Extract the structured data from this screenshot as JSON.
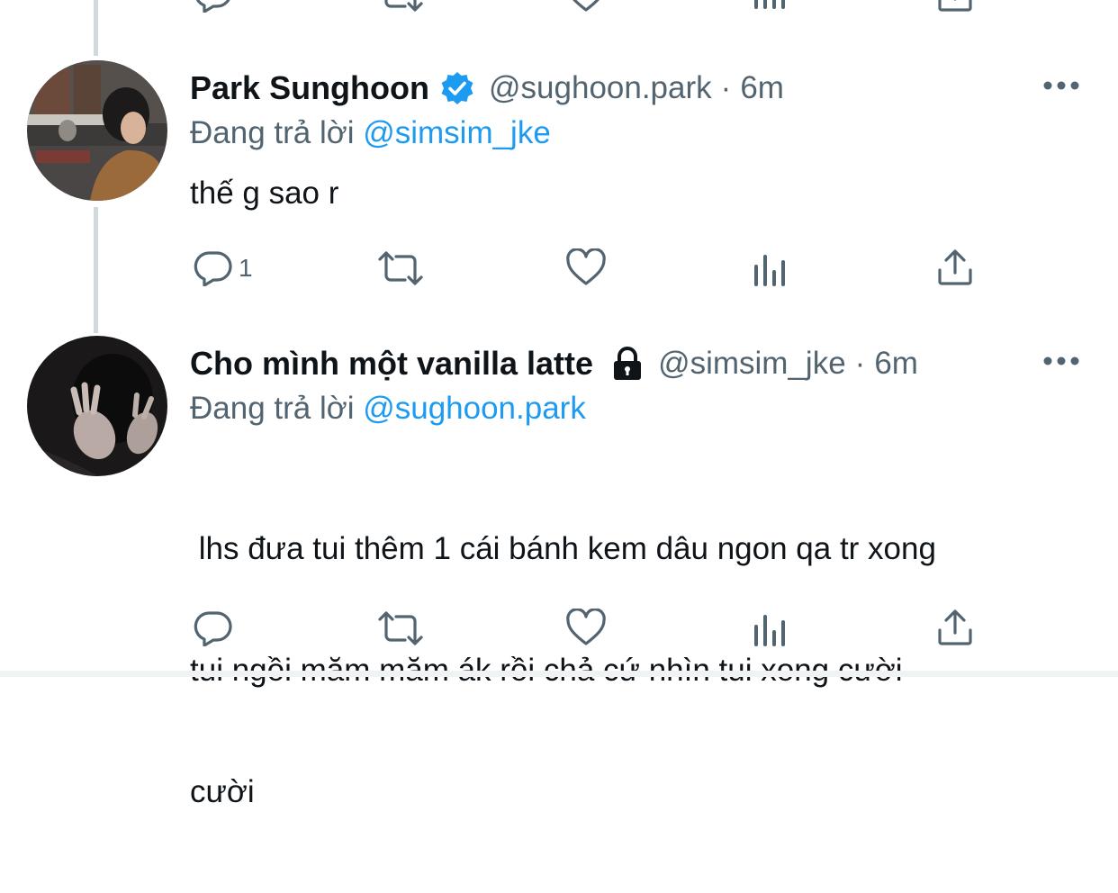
{
  "tweets": [
    {
      "display_name": "Park Sunghoon",
      "verified": true,
      "handle": "@sughoon.park",
      "separator": "·",
      "time": "6m",
      "reply_prefix": "Đang trả lời",
      "reply_to": "@simsim_jke",
      "text": "thế g sao r",
      "reply_count": "1"
    },
    {
      "display_name": "Cho mình một vanilla latte",
      "protected": true,
      "handle": "@simsim_jke",
      "separator": "·",
      "time": "6m",
      "reply_prefix": "Đang trả lời",
      "reply_to": "@sughoon.park",
      "text_lines": [
        " lhs đưa tui thêm 1 cái bánh kem dâu ngon qa tr xong",
        "tui ngồi măm măm ák rồi chả cứ nhìn tui xong cười",
        "cười"
      ],
      "reply_count": ""
    }
  ],
  "icons": {
    "reply": "reply-icon",
    "retweet": "retweet-icon",
    "like": "heart-icon",
    "analytics": "analytics-icon",
    "share": "share-icon",
    "more": "more-icon",
    "verified": "verified-badge-icon",
    "protected": "lock-icon"
  },
  "colors": {
    "accent": "#1d9bf0",
    "secondary_text": "#536471",
    "primary_text": "#0f1419",
    "thread_line": "#cfd9de"
  }
}
